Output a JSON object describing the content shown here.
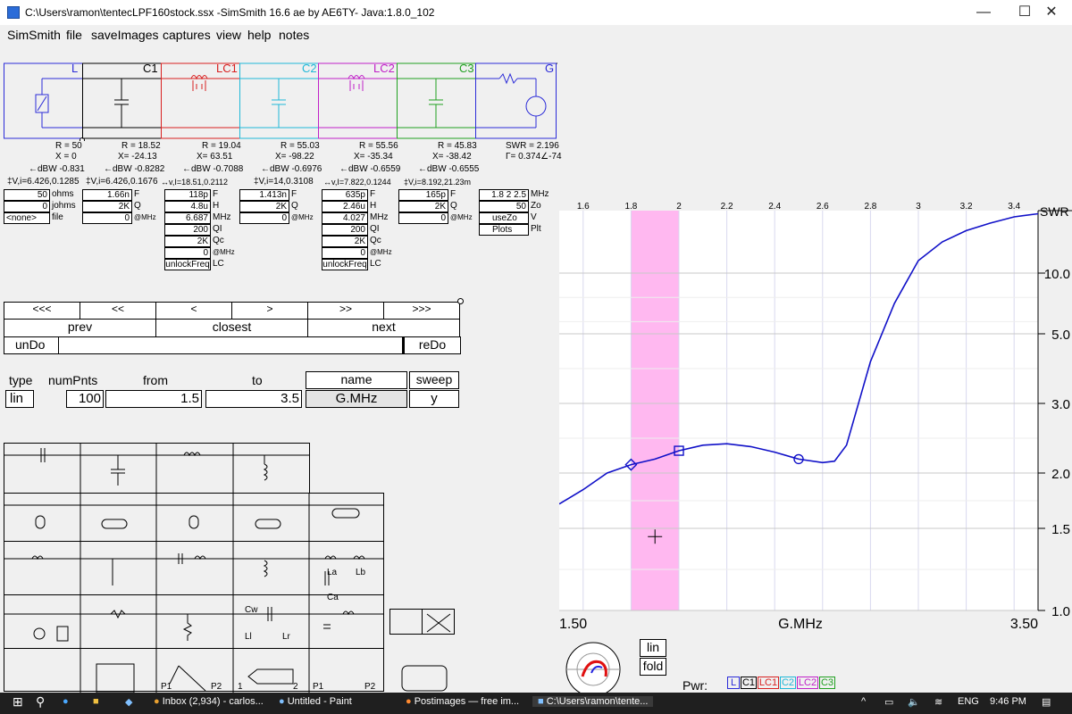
{
  "window": {
    "title": "C:\\Users\\ramon\\tentecLPF160stock.ssx  -SimSmith 16.6 ae by AE6TY-   Java:1.8.0_102",
    "minimize": "—",
    "maximize": "☐",
    "close": "✕"
  },
  "menu": [
    "SimSmith",
    "file",
    "saveImages",
    "captures",
    "view",
    "help",
    "notes"
  ],
  "circuit": {
    "blocks": [
      {
        "name": "L",
        "color": "#2b2bd8",
        "label": "L"
      },
      {
        "name": "C1",
        "color": "#000000",
        "label": "C1"
      },
      {
        "name": "LC1",
        "color": "#d82020",
        "label": "LC1"
      },
      {
        "name": "C2",
        "color": "#20b8d8",
        "label": "C2"
      },
      {
        "name": "LC2",
        "color": "#c020c8",
        "label": "LC2"
      },
      {
        "name": "C3",
        "color": "#20a020",
        "label": "C3"
      },
      {
        "name": "G",
        "color": "#2b2bd8",
        "label": "G"
      }
    ]
  },
  "readouts": {
    "L": {
      "r": "R = 50",
      "x": "X = 0",
      "dbw": "←dBW -0.831",
      "vi": "‡V,i=6.426,0.1285"
    },
    "C1": {
      "r": "R = 18.52",
      "x": "X= -24.13",
      "dbw": "←dBW -0.8282",
      "vi": "‡V,i=6.426,0.1676"
    },
    "LC1": {
      "r": "R = 19.04",
      "x": "X= 63.51",
      "dbw": "←dBW -0.7088",
      "vi": "↔v,I=18.51,0.2112"
    },
    "C2": {
      "r": "R = 55.03",
      "x": "X= -98.22",
      "dbw": "←dBW -0.6976",
      "vi": "‡V,i=14,0.3108"
    },
    "LC2": {
      "r": "R = 55.56",
      "x": "X= -35.34",
      "dbw": "←dBW -0.6559",
      "vi": "↔v,I=7.822,0.1244"
    },
    "C3": {
      "r": "R = 45.83",
      "x": "X= -38.42",
      "dbw": "←dBW -0.6555",
      "vi": "‡V,i=8.192,21.23m"
    },
    "G": {
      "swr": "SWR = 2.196",
      "gamma": "Γ= 0.374∠-74"
    }
  },
  "params": {
    "L": [
      [
        "50",
        "ohms"
      ],
      [
        "0",
        "johms"
      ],
      [
        "<none>",
        "file"
      ]
    ],
    "C1": [
      [
        "1.66n",
        "F"
      ],
      [
        "2K",
        "Q"
      ],
      [
        "0",
        "@MHz"
      ]
    ],
    "LC1": [
      [
        "118p",
        "F"
      ],
      [
        "4.8u",
        "H"
      ],
      [
        "6.687",
        "MHz"
      ],
      [
        "200",
        "QI"
      ],
      [
        "2K",
        "Qc"
      ],
      [
        "0",
        "@MHz"
      ],
      [
        "unlockFreq",
        "LC"
      ]
    ],
    "C2": [
      [
        "1.413n",
        "F"
      ],
      [
        "2K",
        "Q"
      ],
      [
        "0",
        "@MHz"
      ]
    ],
    "LC2": [
      [
        "635p",
        "F"
      ],
      [
        "2.46u",
        "H"
      ],
      [
        "4.027",
        "MHz"
      ],
      [
        "200",
        "QI"
      ],
      [
        "2K",
        "Qc"
      ],
      [
        "0",
        "@MHz"
      ],
      [
        "unlockFreq",
        "LC"
      ]
    ],
    "C3": [
      [
        "165p",
        "F"
      ],
      [
        "2K",
        "Q"
      ],
      [
        "0",
        "@MHz"
      ]
    ],
    "G": [
      [
        "1.8 2 2.5",
        "MHz"
      ],
      [
        "50",
        "Zo"
      ],
      [
        "useZo",
        "V"
      ],
      [
        "Plots",
        "Plt"
      ]
    ]
  },
  "nav": {
    "row1": [
      "<<<",
      "<<",
      "<",
      ">",
      ">>",
      ">>>"
    ],
    "prev": "prev",
    "closest": "closest",
    "next": "next",
    "undo": "unDo",
    "redo": "reDo"
  },
  "sweep": {
    "type_label": "type",
    "numpnts_label": "numPnts",
    "from_label": "from",
    "to_label": "to",
    "name_label": "name",
    "sweep_label": "sweep",
    "type": "lin",
    "numpnts": "100",
    "from": "1.5",
    "to": "3.5",
    "name": "G.MHz",
    "sweep": "y"
  },
  "palette_labels": {
    "cw": "Cw",
    "ll": "Ll",
    "lr": "Lr",
    "la": "La",
    "lb": "Lb",
    "ca": "Ca",
    "p1a": "P1",
    "p2a": "P2",
    "p1b": "1",
    "p2b": "2",
    "p1c": "P1",
    "p2c": "P2"
  },
  "smith_controls": {
    "lin": "lin",
    "fold": "fold",
    "pwr": "Pwr:",
    "pwr_items": [
      "L",
      "C1",
      "LC1",
      "C2",
      "LC2",
      "C3"
    ]
  },
  "chart_data": {
    "type": "line",
    "title": "",
    "xlabel": "G.MHz",
    "ylabel": "SWR",
    "x_ticks_top": [
      "1.6",
      "1.8",
      "2",
      "2.2",
      "2.4",
      "2.6",
      "2.8",
      "3",
      "3.2",
      "3.4"
    ],
    "x_range_labels": [
      "1.50",
      "3.50"
    ],
    "y_ticks": [
      "10.0",
      "5.0",
      "3.0",
      "2.0",
      "1.5",
      "1.0"
    ],
    "xlim": [
      1.5,
      3.5
    ],
    "highlight_band": [
      1.8,
      2.0
    ],
    "series": [
      {
        "color": "#1010c8",
        "x": [
          1.5,
          1.6,
          1.7,
          1.8,
          1.9,
          2.0,
          2.1,
          2.2,
          2.3,
          2.4,
          2.5,
          2.6,
          2.65,
          2.7,
          2.8,
          2.9,
          3.0,
          3.1,
          3.2,
          3.3,
          3.4,
          3.5
        ],
        "y": [
          1.72,
          1.85,
          2.0,
          2.12,
          2.2,
          2.32,
          2.4,
          2.42,
          2.38,
          2.3,
          2.2,
          2.15,
          2.17,
          2.4,
          4.2,
          7.5,
          12.0,
          15.0,
          16.8,
          18.0,
          19.0,
          19.5
        ]
      }
    ],
    "markers": [
      {
        "shape": "diamond",
        "x": 1.8,
        "y": 2.12
      },
      {
        "shape": "square",
        "x": 2.0,
        "y": 2.32
      },
      {
        "shape": "circle",
        "x": 2.5,
        "y": 2.2
      }
    ],
    "cursor": {
      "x": 1.9,
      "y": 1.45
    }
  },
  "taskbar": {
    "items": [
      "Inbox (2,934) - carlos...",
      "Untitled - Paint",
      "Postimages — free im...",
      "C:\\Users\\ramon\\tente..."
    ],
    "lang": "ENG",
    "time": "9:46 PM"
  }
}
